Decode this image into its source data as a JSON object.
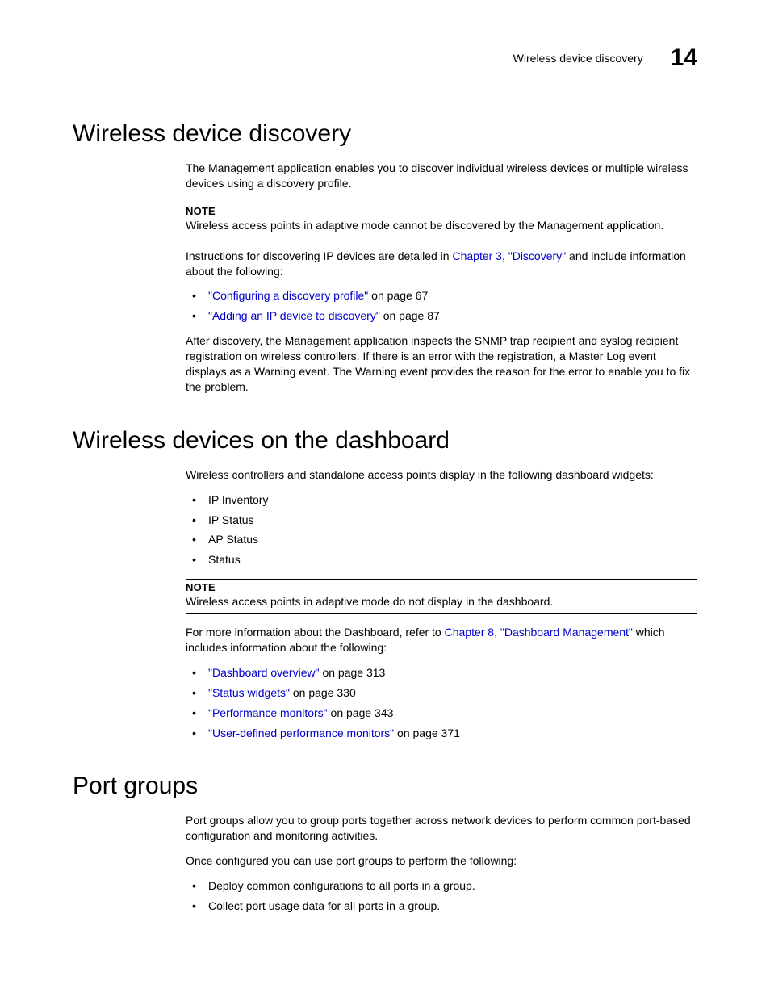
{
  "header": {
    "title": "Wireless device discovery",
    "chapter_number": "14"
  },
  "section1": {
    "heading": "Wireless device discovery",
    "p1": "The Management application enables you to discover individual wireless devices or multiple wireless devices using a discovery profile.",
    "note_label": "NOTE",
    "note_text": "Wireless access points in adaptive mode cannot be discovered by the Management application.",
    "p2_a": "Instructions for discovering IP devices are detailed in ",
    "p2_link": "Chapter 3, \"Discovery\"",
    "p2_b": " and include information about the following:",
    "bullets": [
      {
        "link": "\"Configuring a discovery profile\"",
        "suffix": " on page 67"
      },
      {
        "link": "\"Adding an IP device to discovery\"",
        "suffix": " on page 87"
      }
    ],
    "p3": "After discovery, the Management application inspects the SNMP trap recipient and syslog recipient registration on wireless controllers. If there is an error with the registration, a Master Log event displays as a Warning event. The Warning event provides the reason for the error to enable you to fix the problem."
  },
  "section2": {
    "heading": "Wireless devices on the dashboard",
    "p1": "Wireless controllers and standalone access points display in the following dashboard widgets:",
    "bullets_plain": [
      "IP Inventory",
      "IP Status",
      "AP Status",
      "Status"
    ],
    "note_label": "NOTE",
    "note_text": "Wireless access points in adaptive mode do not display in the dashboard.",
    "p2_a": "For more information about the Dashboard, refer to ",
    "p2_link": "Chapter 8, \"Dashboard Management\"",
    "p2_b": " which includes information about the following:",
    "bullets_links": [
      {
        "link": "\"Dashboard overview\"",
        "suffix": " on page 313"
      },
      {
        "link": "\"Status widgets\"",
        "suffix": " on page 330"
      },
      {
        "link": "\"Performance monitors\"",
        "suffix": " on page 343"
      },
      {
        "link": "\"User-defined performance monitors\"",
        "suffix": " on page 371"
      }
    ]
  },
  "section3": {
    "heading": "Port groups",
    "p1": "Port groups allow you to group ports together across network devices to perform common port-based configuration and monitoring activities.",
    "p2": "Once configured you can use port groups to perform the following:",
    "bullets_plain": [
      "Deploy common configurations to all ports in a group.",
      "Collect port usage data for all ports in a group."
    ]
  }
}
